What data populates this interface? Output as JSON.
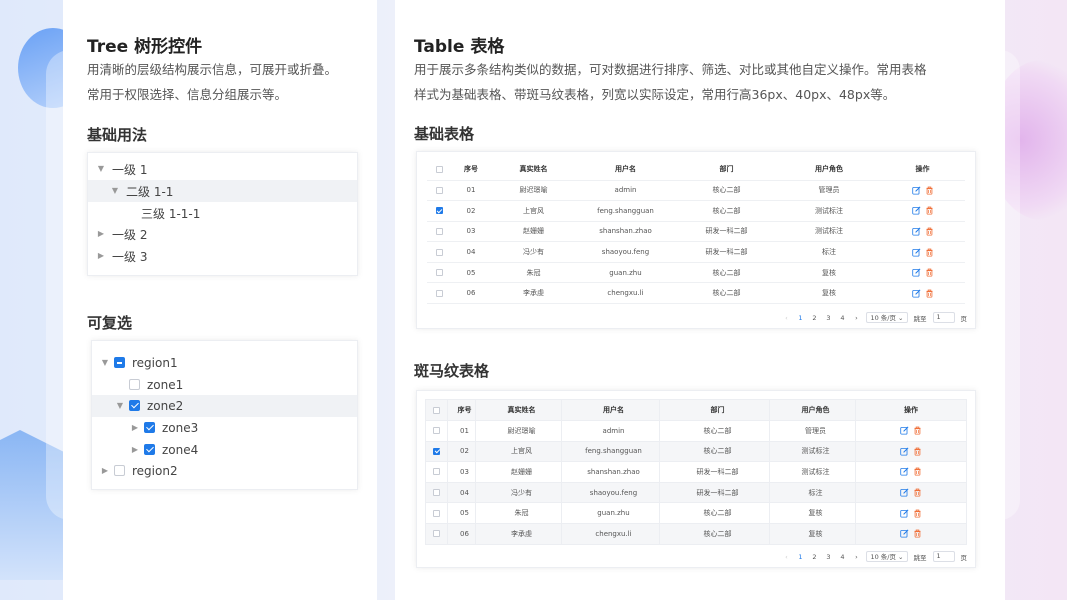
{
  "tree_section": {
    "title": "Tree 树形控件",
    "desc_line1": "用清晰的层级结构展示信息，可展开或折叠。",
    "desc_line2": "常用于权限选择、信息分组展示等。",
    "basic": {
      "title": "基础用法",
      "nodes": [
        "一级 1",
        "二级 1-1",
        "三级 1-1-1",
        "一级 2",
        "一级 3"
      ]
    },
    "checkable": {
      "title": "可复选",
      "nodes": [
        "region1",
        "zone1",
        "zone2",
        "zone3",
        "zone4",
        "region2"
      ]
    }
  },
  "table_section": {
    "title": "Table 表格",
    "desc_line1": "用于展示多条结构类似的数据，可对数据进行排序、筛选、对比或其他自定义操作。常用表格",
    "desc_line2": "样式为基础表格、带斑马纹表格，列宽以实际设定，常用行高36px、40px、48px等。",
    "basic_title": "基础表格",
    "zebra_title": "斑马纹表格",
    "columns": [
      "序号",
      "真实姓名",
      "用户名",
      "部门",
      "用户角色",
      "操作"
    ],
    "rows": [
      {
        "no": "01",
        "name": "尉迟璟喻",
        "user": "admin",
        "dept": "核心二部",
        "role": "管理员"
      },
      {
        "no": "02",
        "name": "上官风",
        "user": "feng.shangguan",
        "dept": "核心二部",
        "role": "测试标注"
      },
      {
        "no": "03",
        "name": "赵姗姗",
        "user": "shanshan.zhao",
        "dept": "研发一科二部",
        "role": "测试标注"
      },
      {
        "no": "04",
        "name": "冯少有",
        "user": "shaoyou.feng",
        "dept": "研发一科二部",
        "role": "标注"
      },
      {
        "no": "05",
        "name": "朱冠",
        "user": "guan.zhu",
        "dept": "核心二部",
        "role": "复核"
      },
      {
        "no": "06",
        "name": "李承虔",
        "user": "chengxu.li",
        "dept": "核心二部",
        "role": "复核"
      }
    ],
    "pagination": {
      "prev": "‹",
      "pages": [
        "1",
        "2",
        "3",
        "4"
      ],
      "next": "›",
      "page_size": "10 条/页 ⌄",
      "jump_label": "跳至",
      "jump_value": "1",
      "page_unit": "页"
    }
  },
  "colors": {
    "accent": "#1f7ae8",
    "edit_icon": "#1f7ae8",
    "delete_icon": "#f0703a"
  }
}
